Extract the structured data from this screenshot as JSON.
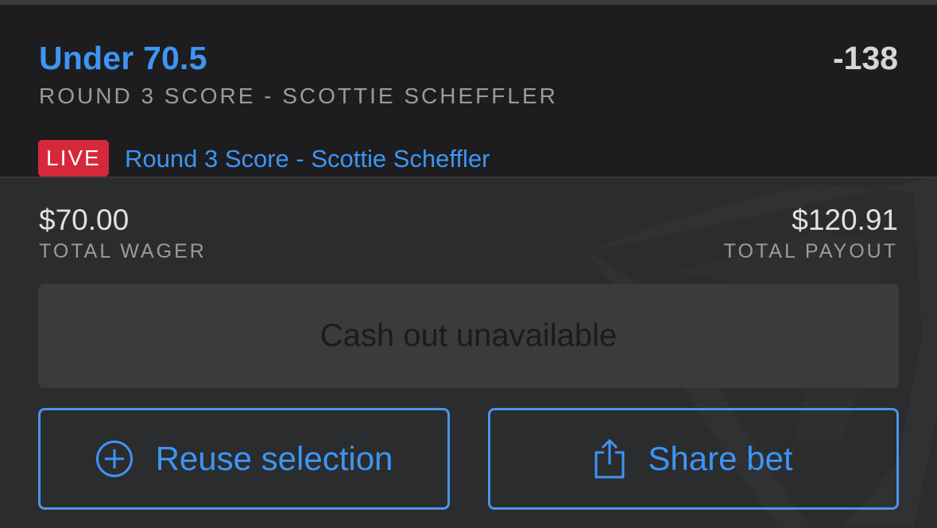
{
  "bet": {
    "selection": "Under 70.5",
    "odds": "-138",
    "market": "ROUND 3 SCORE - SCOTTIE SCHEFFLER",
    "live_badge": "LIVE",
    "event_link": "Round 3 Score - Scottie Scheffler"
  },
  "totals": {
    "wager_amount": "$70.00",
    "wager_label": "TOTAL WAGER",
    "payout_amount": "$120.91",
    "payout_label": "TOTAL PAYOUT"
  },
  "actions": {
    "cashout_label": "Cash out unavailable",
    "reuse_label": "Reuse selection",
    "share_label": "Share bet"
  },
  "icons": {
    "reuse": "plus-circle-icon",
    "share": "share-icon",
    "watermark": "brand-shield-logo"
  },
  "colors": {
    "accent": "#3d95f4",
    "live": "#d6283b",
    "background": "#2b2c2e",
    "header": "#1d1d1f"
  }
}
